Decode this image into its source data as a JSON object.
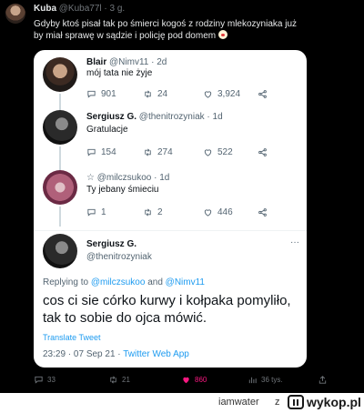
{
  "post": {
    "author_name": "Kuba",
    "author_handle": "@Kuba77l",
    "time": "· 3 g.",
    "text": "Gdyby ktoś pisał tak po śmierci kogoś z rodziny mlekozyniaka już by miał sprawę w sądzie i policję pod domem",
    "emoji_icon": "clown-face-icon"
  },
  "screenshot": {
    "replies": [
      {
        "name": "Blair",
        "handle": "@Nimv11 · 2d",
        "text": "mój tata nie żyje",
        "stats": {
          "reply": "901",
          "retweet": "24",
          "like": "3,924"
        }
      },
      {
        "name": "Sergiusz G.",
        "handle": "@thenitrozyniak · 1d",
        "text": "Gratulacje",
        "stats": {
          "reply": "154",
          "retweet": "274",
          "like": "522"
        }
      },
      {
        "name": "☆",
        "handle": "@milczsukoo · 1d",
        "text": "Ty jebany śmieciu",
        "stats": {
          "reply": "1",
          "retweet": "2",
          "like": "446"
        }
      }
    ],
    "main": {
      "name": "Sergiusz G.",
      "handle": "@thenitrozyniak",
      "more": "···",
      "replying_prefix": "Replying to",
      "replying_user1": "@milczsukoo",
      "replying_and": "and",
      "replying_user2": "@Nimv11",
      "text": "cos ci sie córko kurwy i kołpaka pomyliło, tak to sobie do ojca mówić.",
      "translate": "Translate Tweet",
      "timestamp": "23:29 · 07 Sep 21 ·",
      "app": "Twitter Web App"
    }
  },
  "bottom_stats": {
    "replies": "33",
    "retweets": "21",
    "likes": "860",
    "views": "36 tys."
  },
  "footer": {
    "user": "iamwater",
    "z": "z",
    "site": "wykop.pl"
  },
  "colors": {
    "background": "#000000",
    "accent_blue": "#1d9bf0",
    "like_pink": "#f91880",
    "muted": "#71767b"
  }
}
